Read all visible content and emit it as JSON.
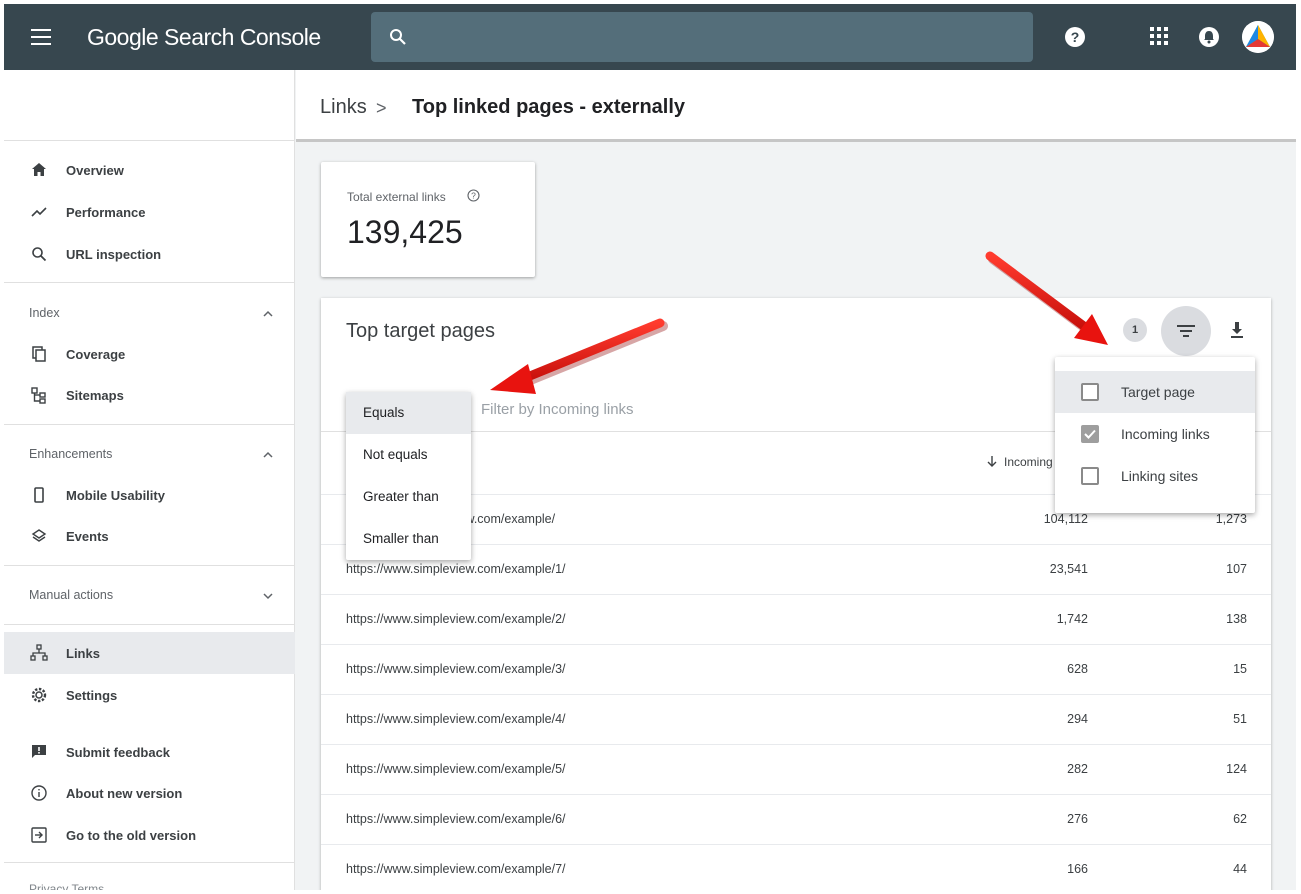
{
  "app": {
    "title": "Google Search Console"
  },
  "search": {
    "placeholder": ""
  },
  "breadcrumb": {
    "parent": "Links",
    "separator": ">",
    "current": "Top linked pages - externally"
  },
  "sidebar": {
    "items_top": [
      {
        "label": "Overview",
        "icon": "home-icon"
      },
      {
        "label": "Performance",
        "icon": "trending-icon"
      },
      {
        "label": "URL inspection",
        "icon": "search-icon"
      }
    ],
    "index_header": "Index",
    "index_items": [
      {
        "label": "Coverage",
        "icon": "coverage-icon"
      },
      {
        "label": "Sitemaps",
        "icon": "sitemap-icon"
      }
    ],
    "enh_header": "Enhancements",
    "enh_items": [
      {
        "label": "Mobile Usability",
        "icon": "phone-icon"
      },
      {
        "label": "Events",
        "icon": "events-icon"
      }
    ],
    "manual_header": "Manual actions",
    "bottom_items": [
      {
        "label": "Links",
        "icon": "links-icon"
      },
      {
        "label": "Settings",
        "icon": "gear-icon"
      }
    ],
    "footer_items": [
      {
        "label": "Submit feedback",
        "icon": "feedback-icon"
      },
      {
        "label": "About new version",
        "icon": "info-icon"
      },
      {
        "label": "Go to the old version",
        "icon": "exit-icon"
      }
    ],
    "footer_links": "Privacy   Terms"
  },
  "total": {
    "label": "Total external links",
    "value": "139,425"
  },
  "table": {
    "title": "Top target pages",
    "filter_badge": "1",
    "filter_placeholder": "Filter by Incoming links",
    "incoming_header": "Incoming",
    "rows": [
      {
        "url": "https://www.simpleview.com/example/",
        "incoming": "104,112",
        "sites": "1,273"
      },
      {
        "url": "https://www.simpleview.com/example/1/",
        "incoming": "23,541",
        "sites": "107"
      },
      {
        "url": "https://www.simpleview.com/example/2/",
        "incoming": "1,742",
        "sites": "138"
      },
      {
        "url": "https://www.simpleview.com/example/3/",
        "incoming": "628",
        "sites": "15"
      },
      {
        "url": "https://www.simpleview.com/example/4/",
        "incoming": "294",
        "sites": "51"
      },
      {
        "url": "https://www.simpleview.com/example/5/",
        "incoming": "282",
        "sites": "124"
      },
      {
        "url": "https://www.simpleview.com/example/6/",
        "incoming": "276",
        "sites": "62"
      },
      {
        "url": "https://www.simpleview.com/example/7/",
        "incoming": "166",
        "sites": "44"
      }
    ]
  },
  "operator_menu": [
    "Equals",
    "Not equals",
    "Greater than",
    "Smaller than"
  ],
  "column_menu": [
    {
      "label": "Target page",
      "checked": false
    },
    {
      "label": "Incoming links",
      "checked": true
    },
    {
      "label": "Linking sites",
      "checked": false
    }
  ],
  "colors": {
    "topbar": "#37474f",
    "search": "#546e7a",
    "arrow": "#e8130f"
  }
}
